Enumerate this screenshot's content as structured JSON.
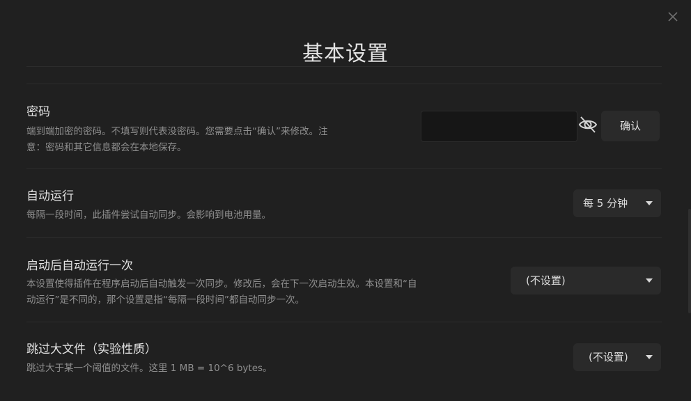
{
  "modal": {
    "title": "基本设置",
    "close_label": "×"
  },
  "settings": [
    {
      "name": "密码",
      "desc_line1": "端到端加密的密码。不填写则代表没密码。您需要点击“确认”来修改。注",
      "desc_line2": "意：密码和其它信息都会在本地保存。",
      "input_value": "",
      "eye_icon": "eye-off-icon",
      "confirm_label": "确认"
    },
    {
      "name": "自动运行",
      "desc_line1": "每隔一段时间，此插件尝试自动同步。会影响到电池用量。",
      "selected": "每 5 分钟"
    },
    {
      "name": "启动后自动运行一次",
      "desc_line1": "本设置使得插件在程序启动后自动触发一次同步。修改后，会在下一次启动生效。本设置和“自",
      "desc_line2": "动运行”是不同的，那个设置是指“每隔一段时间”都自动同步一次。",
      "selected": "(不设置)"
    },
    {
      "name": "跳过大文件（实验性质）",
      "desc_line1": "跳过大于某一个阈值的文件。这里 1 MB = 10^6 bytes。",
      "selected": "(不设置)"
    }
  ]
}
